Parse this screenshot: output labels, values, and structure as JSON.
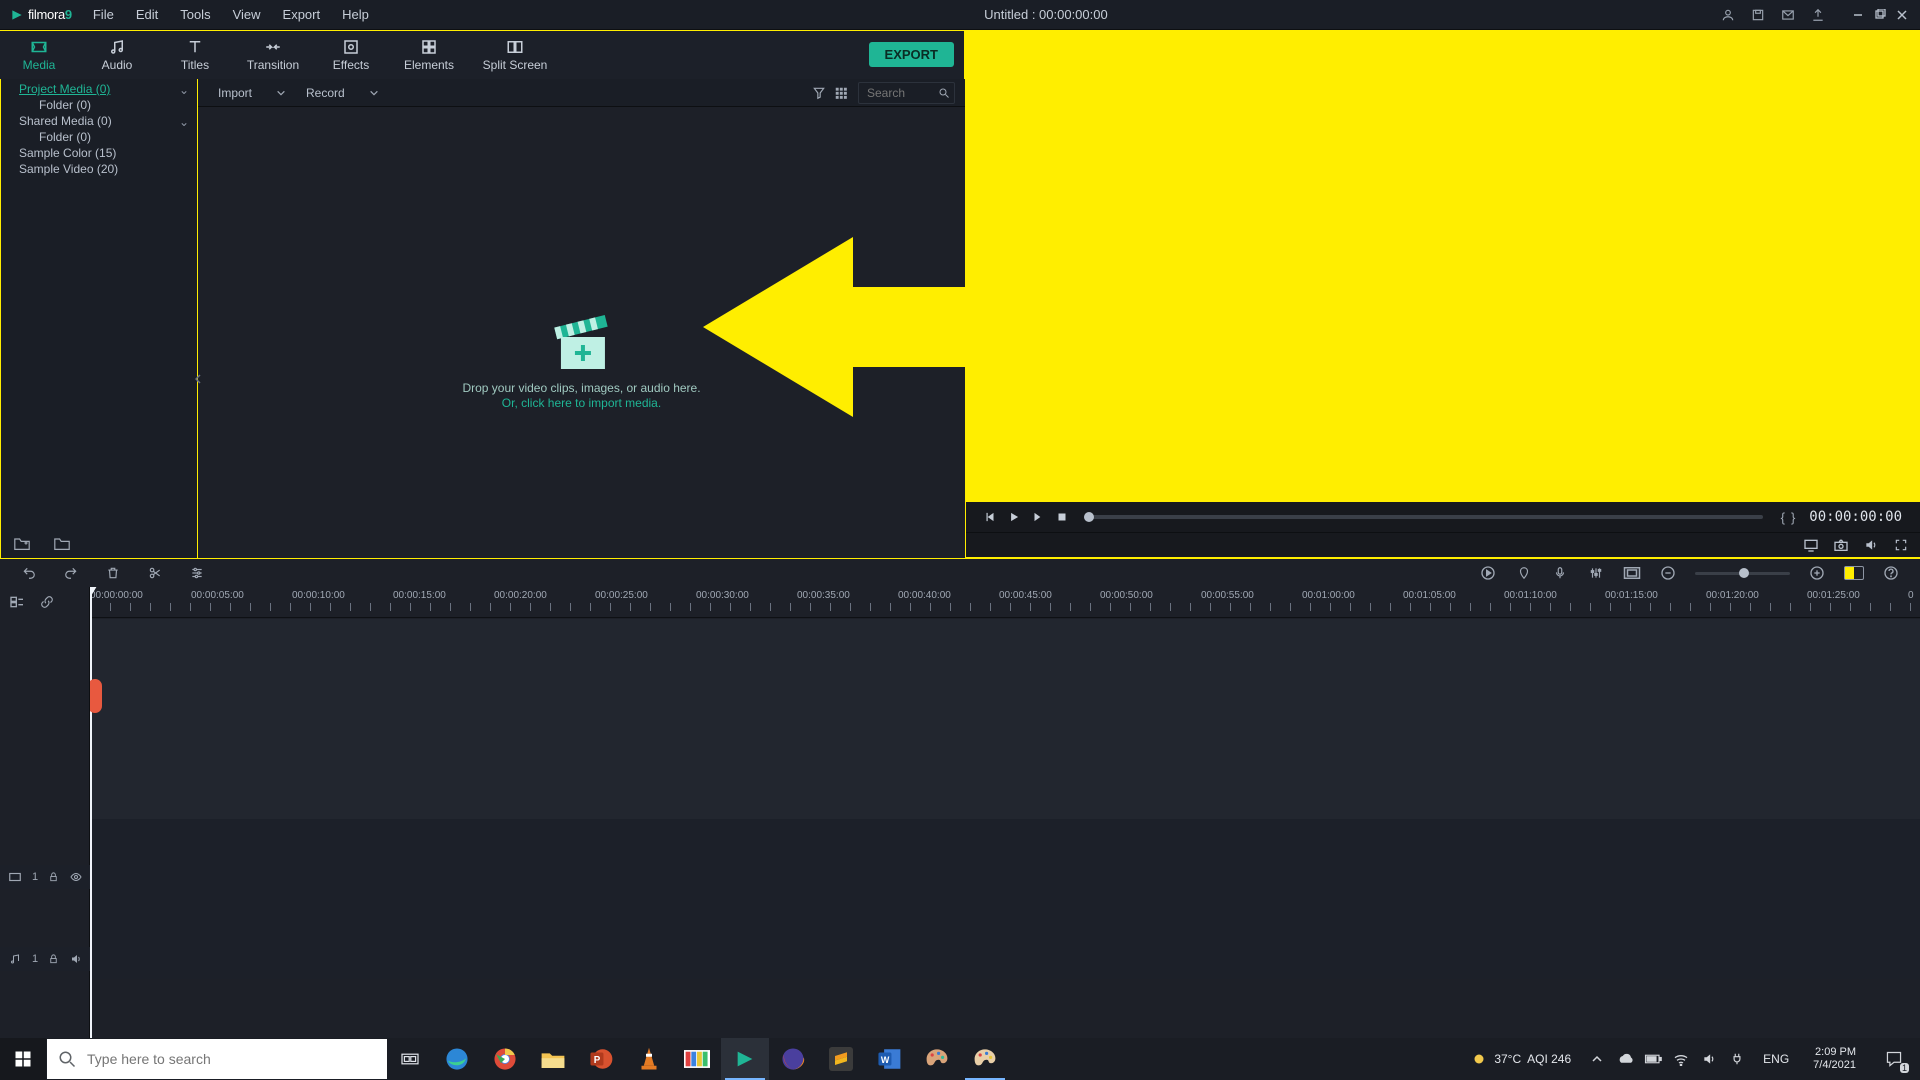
{
  "app_logo": {
    "name": "filmora",
    "suffix": "9"
  },
  "menu": [
    "File",
    "Edit",
    "Tools",
    "View",
    "Export",
    "Help"
  ],
  "title": "Untitled : 00:00:00:00",
  "ribbon": {
    "tabs": [
      "Media",
      "Audio",
      "Titles",
      "Transition",
      "Effects",
      "Elements",
      "Split Screen"
    ],
    "selected": 0,
    "export_label": "EXPORT"
  },
  "tree": {
    "items": [
      {
        "label": "Project Media (0)",
        "level": 0,
        "selected": true,
        "expandable": true
      },
      {
        "label": "Folder (0)",
        "level": 1
      },
      {
        "label": "Shared Media (0)",
        "level": 0,
        "expandable": true
      },
      {
        "label": "Folder (0)",
        "level": 1
      },
      {
        "label": "Sample Color (15)",
        "level": 0
      },
      {
        "label": "Sample Video (20)",
        "level": 0
      }
    ]
  },
  "media_bar": {
    "import_label": "Import",
    "record_label": "Record",
    "search_placeholder": "Search"
  },
  "dropzone": {
    "line1": "Drop your video clips, images, or audio here.",
    "line2": "Or, click here to import media."
  },
  "preview": {
    "time": "00:00:00:00"
  },
  "ruler_marks": [
    "00:00:00:00",
    "00:00:05:00",
    "00:00:10:00",
    "00:00:15:00",
    "00:00:20:00",
    "00:00:25:00",
    "00:00:30:00",
    "00:00:35:00",
    "00:00:40:00",
    "00:00:45:00",
    "00:00:50:00",
    "00:00:55:00",
    "00:01:00:00",
    "00:01:05:00",
    "00:01:10:00",
    "00:01:15:00",
    "00:01:20:00",
    "00:01:25:00",
    "0"
  ],
  "tracks": {
    "video": {
      "label": "1"
    },
    "audio": {
      "label": "1"
    }
  },
  "taskbar": {
    "search_placeholder": "Type here to search",
    "weather_temp": "37°C",
    "weather_aqi": "AQI 246",
    "lang": "ENG",
    "time": "2:09 PM",
    "date": "7/4/2021"
  }
}
